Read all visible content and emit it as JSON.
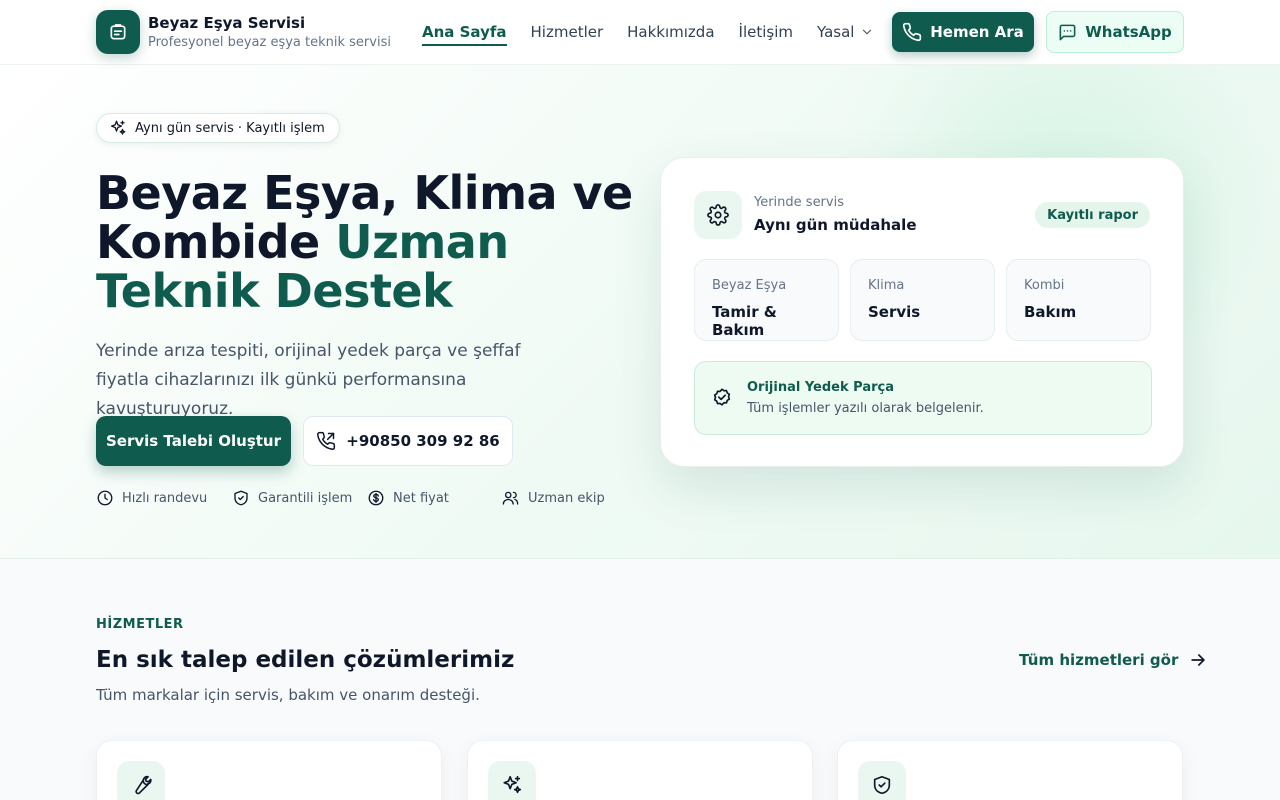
{
  "brand": {
    "title": "Beyaz Eşya Servisi",
    "subtitle": "Profesyonel beyaz eşya teknik servisi",
    "icon": "washing-machine-icon"
  },
  "nav": {
    "items": [
      {
        "label": "Ana Sayfa",
        "active": true
      },
      {
        "label": "Hizmetler"
      },
      {
        "label": "Hakkımızda"
      },
      {
        "label": "İletişim"
      },
      {
        "label": "Yasal",
        "dropdown": true
      }
    ]
  },
  "header_actions": {
    "call_label": "Hemen Ara",
    "whatsapp_label": "WhatsApp"
  },
  "hero": {
    "pill": "Aynı gün servis · Kayıtlı işlem",
    "title_part1": "Beyaz Eşya, Klima ve Kombide ",
    "title_accent": "Uzman Teknik Destek",
    "description": "Yerinde arıza tespiti, orijinal yedek parça ve şeffaf fiyatla cihazlarınızı ilk günkü performansına kavuşturuyoruz.",
    "primary_cta": "Servis Talebi Oluştur",
    "phone": "+90850 309 92 86",
    "features": [
      "Hızlı randevu",
      "Garantili işlem",
      "Net fiyat",
      "Uzman ekip"
    ]
  },
  "hero_card": {
    "small": "Yerinde servis",
    "main": "Aynı gün müdahale",
    "badge": "Kayıtlı rapor",
    "services": [
      {
        "label": "Beyaz Eşya",
        "value": "Tamir & Bakım"
      },
      {
        "label": "Klima",
        "value": "Servis"
      },
      {
        "label": "Kombi",
        "value": "Bakım"
      }
    ],
    "notice_title": "Orijinal Yedek Parça",
    "notice_desc": "Tüm işlemler yazılı olarak belgelenir."
  },
  "services_section": {
    "kicker": "HİZMETLER",
    "title": "En sık talep edilen çözümlerimiz",
    "subtitle": "Tüm markalar için servis, bakım ve onarım desteği.",
    "all_link": "Tüm hizmetleri gör",
    "card_icons": [
      "wrench-icon",
      "sparkles-icon",
      "shield-check-icon"
    ]
  },
  "colors": {
    "primary": "#0f5c4e",
    "accent_bg": "#eaf7f0",
    "text": "#0f172a",
    "muted": "#64748b"
  }
}
